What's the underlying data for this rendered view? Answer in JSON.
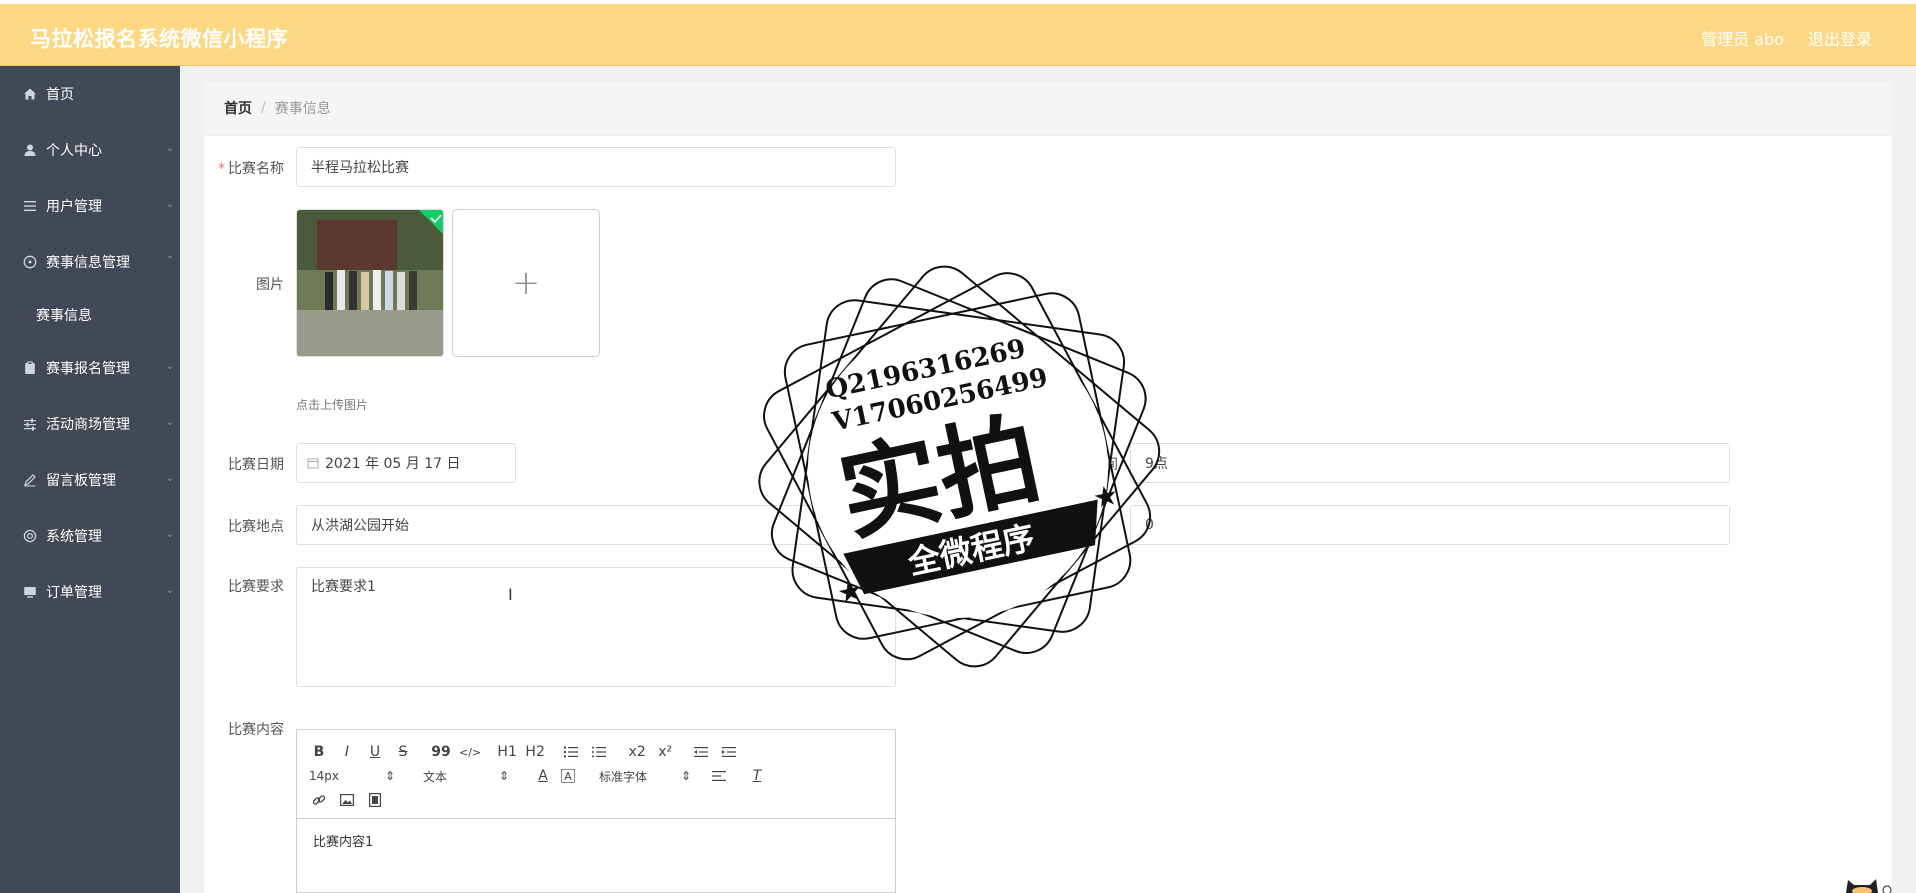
{
  "header": {
    "title": "马拉松报名系统微信小程序",
    "admin_label": "管理员 abo",
    "logout_label": "退出登录"
  },
  "sidebar": {
    "items": [
      {
        "label": "首页",
        "icon": "home-icon"
      },
      {
        "label": "个人中心",
        "icon": "user-icon"
      },
      {
        "label": "用户管理",
        "icon": "list-icon"
      },
      {
        "label": "赛事信息管理",
        "icon": "compass-icon"
      },
      {
        "label": "赛事报名管理",
        "icon": "clipboard-icon"
      },
      {
        "label": "活动商场管理",
        "icon": "sliders-icon"
      },
      {
        "label": "留言板管理",
        "icon": "edit-icon"
      },
      {
        "label": "系统管理",
        "icon": "settings-icon"
      },
      {
        "label": "订单管理",
        "icon": "monitor-icon"
      }
    ],
    "sub_items": [
      {
        "label": "赛事信息"
      }
    ]
  },
  "breadcrumb": {
    "home": "首页",
    "separator": "/",
    "current": "赛事信息"
  },
  "form": {
    "name_label": "比赛名称",
    "name_value": "半程马拉松比赛",
    "image_label": "图片",
    "upload_hint": "点击上传图片",
    "upload_plus": "+",
    "date_label": "比赛日期",
    "date_value": "2021 年 05 月 17 日",
    "time_label": "比赛时间",
    "time_label_visible": "比赛时间",
    "time_value": "9点",
    "location_label": "比赛地点",
    "location_value": "从洪湖公园开始",
    "count_value": "0",
    "requirements_label": "比赛要求",
    "requirements_value": "比赛要求1",
    "content_label": "比赛内容",
    "content_value": "比赛内容1"
  },
  "editor_toolbar": {
    "font_size": "14px",
    "paragraph": "文本",
    "font_family": "标准字体",
    "buttons": [
      "B",
      "I",
      "U",
      "S",
      "99",
      "</>",
      "H1",
      "H2",
      "x2",
      "x²"
    ]
  },
  "watermark": {
    "line1": "Q2196316269",
    "line2": "V17060256499",
    "big_text": "实拍",
    "ribbon_text": "全微程序"
  },
  "colors": {
    "header_bg": "#fdd884",
    "sidebar_bg": "#414856",
    "required": "#f56c6c"
  }
}
